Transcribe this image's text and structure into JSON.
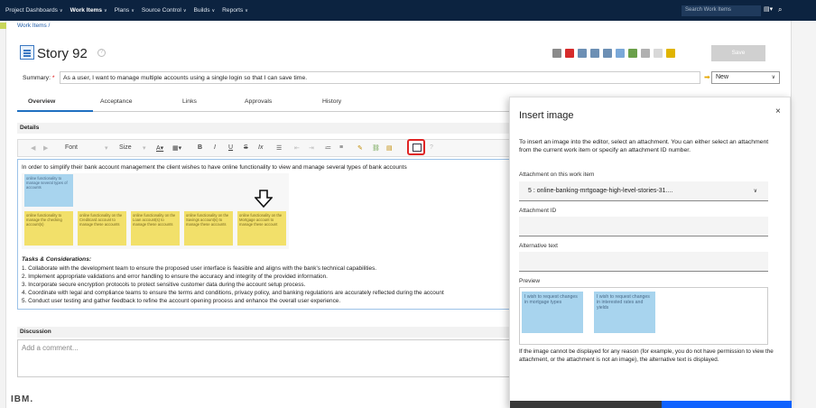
{
  "nav": {
    "items": [
      "Project Dashboards",
      "Work Items",
      "Plans",
      "Source Control",
      "Builds",
      "Reports"
    ],
    "active": "Work Items",
    "search_placeholder": "Search Work Items"
  },
  "breadcrumb": "Work Items /",
  "story": {
    "title": "Story 92",
    "save_label": "Save"
  },
  "summary": {
    "label": "Summary:",
    "required_mark": "*",
    "value": "As a user, I want to manage multiple accounts using a single login so that I can save time."
  },
  "state": {
    "value": "New"
  },
  "tabs": [
    "Overview",
    "Acceptance",
    "Links",
    "Approvals",
    "History"
  ],
  "details_header": "Details",
  "editor_toolbar": {
    "font": "Font",
    "size": "Size"
  },
  "editor": {
    "intro": "In order to simplify their bank account management the client wishes to have online functionality to view and manage several types of bank accounts",
    "stickies_top": [
      "online functionality to manage several types of accounts"
    ],
    "stickies_bottom": [
      "online functionality to manage the checking account(s)",
      "online functionality on the Creditcard account to manage these accounts",
      "online functionality on the Loan account(s) to manage these accounts",
      "online functionality on the Savings account(s) to manage these accounts",
      "online functionality on the Mortgage account to manage these account"
    ],
    "tasks_title": "Tasks & Considerations:",
    "tasks": [
      "1. Collaborate with the development team to ensure the proposed user interface is feasible and aligns with the bank's technical capabilities.",
      "2. Implement appropriate validations and error handling to ensure the accuracy and integrity of the provided information.",
      "3. Incorporate secure encryption protocols to protect sensitive customer data during the account setup process.",
      "4. Coordinate with legal and compliance teams to ensure the terms and conditions, privacy policy, and banking regulations are accurately reflected during the account",
      "5. Conduct user testing and gather feedback to refine the account opening process and enhance the overall user experience."
    ]
  },
  "discussion": {
    "header": "Discussion",
    "placeholder": "Add a comment..."
  },
  "footer_logo": "IBM.",
  "modal": {
    "title": "Insert image",
    "close": "×",
    "description": "To insert an image into the editor, select an attachment. You can either select an attachment from the current work item or specify an attachment ID number.",
    "attachment_label": "Attachment on this work item",
    "attachment_value": "5 : online-banking-mrtgoage-high-level-stories-31....",
    "attachment_id_label": "Attachment ID",
    "alt_text_label": "Alternative text",
    "preview_label": "Preview",
    "preview_stickies": [
      "I wish to request changes in mortgage types",
      "I wish to request changes in interested rates and yields"
    ],
    "note": "If the image cannot be displayed for any reason (for example, you do not have permission to view the attachment, or the attachment is not an image), the alternative text is displayed."
  }
}
